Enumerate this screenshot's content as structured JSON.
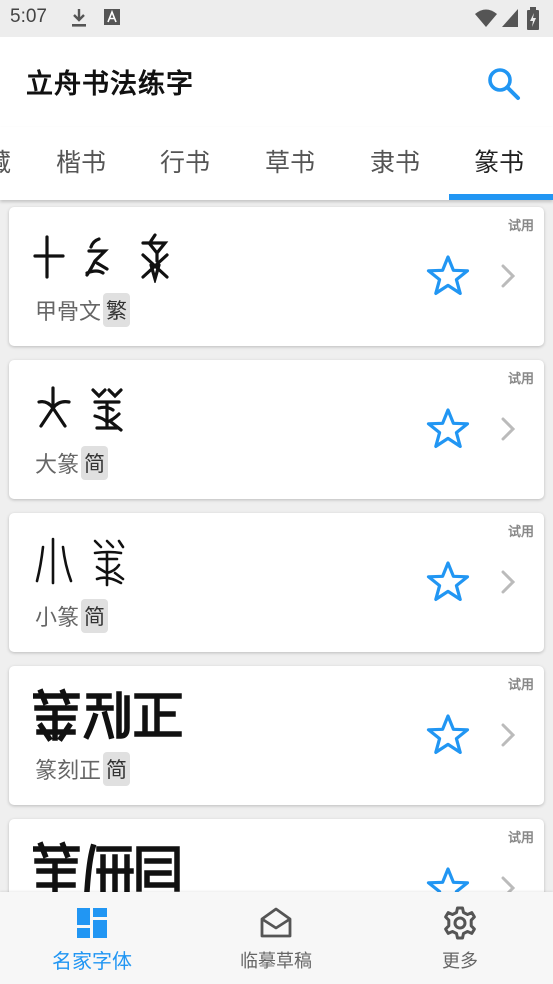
{
  "status_bar": {
    "time": "5:07"
  },
  "app_bar": {
    "title": "立舟书法练字",
    "search_icon": "search-icon"
  },
  "tabs": [
    {
      "label": "藏",
      "active": false
    },
    {
      "label": "楷书",
      "active": false
    },
    {
      "label": "行书",
      "active": false
    },
    {
      "label": "草书",
      "active": false
    },
    {
      "label": "隶书",
      "active": false
    },
    {
      "label": "篆书",
      "active": true
    }
  ],
  "cards": [
    {
      "name": "甲骨文",
      "tag": "繁",
      "badge": "试用",
      "favorite_icon": "star-outline-icon"
    },
    {
      "name": "大篆",
      "tag": "简",
      "badge": "试用",
      "favorite_icon": "star-outline-icon"
    },
    {
      "name": "小篆",
      "tag": "简",
      "badge": "试用",
      "favorite_icon": "star-outline-icon"
    },
    {
      "name": "篆刻正",
      "tag": "简",
      "badge": "试用",
      "favorite_icon": "star-outline-icon"
    },
    {
      "name": "",
      "tag": "",
      "badge": "试用",
      "favorite_icon": "star-outline-icon"
    }
  ],
  "bottom_nav": [
    {
      "label": "名家字体",
      "icon": "dashboard-icon",
      "active": true
    },
    {
      "label": "临摹草稿",
      "icon": "mail-open-icon",
      "active": false
    },
    {
      "label": "更多",
      "icon": "gear-icon",
      "active": false
    }
  ],
  "colors": {
    "accent": "#2196f3",
    "background": "#efefef",
    "card": "#ffffff",
    "tag_bg": "#e0e0e0"
  }
}
